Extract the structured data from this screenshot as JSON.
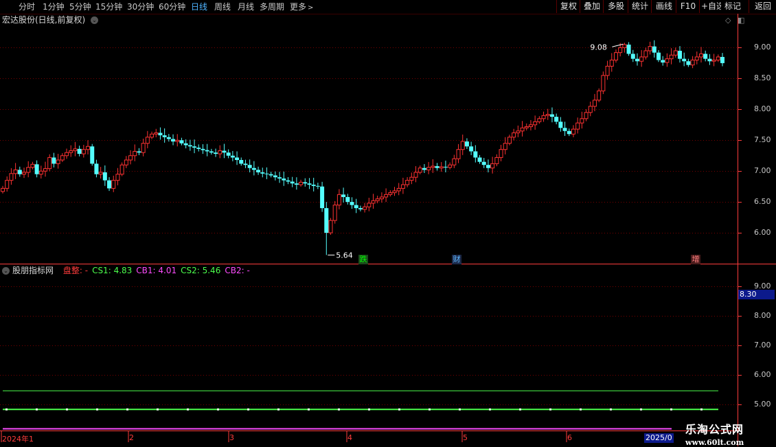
{
  "periods": [
    {
      "label": "分时",
      "active": false
    },
    {
      "label": "1分钟",
      "active": false
    },
    {
      "label": "5分钟",
      "active": false
    },
    {
      "label": "15分钟",
      "active": false
    },
    {
      "label": "30分钟",
      "active": false
    },
    {
      "label": "60分钟",
      "active": false
    },
    {
      "label": "日线",
      "active": true
    },
    {
      "label": "周线",
      "active": false
    },
    {
      "label": "月线",
      "active": false
    },
    {
      "label": "多周期",
      "active": false
    },
    {
      "label": "更多",
      "active": false
    }
  ],
  "toolbar": {
    "restore_rights": "复权",
    "overlay": "叠加",
    "multi_stock": "多股",
    "statistics": "统计",
    "draw_line": "画线",
    "f10": "F10",
    "add_watchlist": "+自选",
    "back": "返回"
  },
  "chart_title": "宏达股份(日线,前复权)",
  "bookmark_label": "标记",
  "indicator": {
    "name": "股朋指标网",
    "items": [
      {
        "label": "盘整",
        "value": "-",
        "color": "#ff3c3c"
      },
      {
        "label": "CS1",
        "value": "4.83",
        "color": "#4cff4c"
      },
      {
        "label": "CB1",
        "value": "4.01",
        "color": "#ff4cff"
      },
      {
        "label": "CS2",
        "value": "5.46",
        "color": "#4cff4c"
      },
      {
        "label": "CB2",
        "value": "-",
        "color": "#ff4cff"
      }
    ]
  },
  "current_price_tag": "8.30",
  "events": [
    {
      "label": "跌",
      "color": "#00ff00",
      "bg": "#1c4a1c"
    },
    {
      "label": "财",
      "color": "#5fb8ff",
      "bg": "#1c2a4a"
    },
    {
      "label": "增",
      "color": "#ff8080",
      "bg": "#4a1c1c"
    }
  ],
  "dates": [
    "2024年1",
    "2",
    "3",
    "4",
    "5",
    "6"
  ],
  "last_date": "2025/0",
  "watermark": {
    "line1": "乐淘公式网",
    "line2": "www.60lt.com"
  },
  "colors": {
    "up": "#ff3232",
    "down": "#54ffff",
    "grid": "#7a0000",
    "axis": "#ff3c3c",
    "active": "#4fb4ff",
    "cs": "#4cff4c",
    "cb": "#ff4cff"
  },
  "chart_data": {
    "type": "candlestick",
    "title": "宏达股份(日线,前复权)",
    "main_axis": {
      "ticks": [
        6.0,
        6.5,
        7.0,
        7.5,
        8.0,
        8.5,
        9.0
      ],
      "range": [
        5.5,
        9.35
      ]
    },
    "indicator_axis": {
      "ticks": [
        5.0,
        6.0,
        7.0,
        8.0,
        9.0
      ],
      "range": [
        4.65,
        9.35
      ]
    },
    "annotations": [
      {
        "label": "9.08",
        "type": "high"
      },
      {
        "label": "5.64",
        "type": "low"
      }
    ],
    "close": [
      6.72,
      6.85,
      6.96,
      7.02,
      6.95,
      6.98,
      7.06,
      7.11,
      6.95,
      7.0,
      7.04,
      7.22,
      7.12,
      7.18,
      7.25,
      7.3,
      7.33,
      7.36,
      7.28,
      7.35,
      7.4,
      7.12,
      6.95,
      6.98,
      6.85,
      6.72,
      6.85,
      6.95,
      7.1,
      7.18,
      7.25,
      7.32,
      7.3,
      7.45,
      7.55,
      7.6,
      7.62,
      7.58,
      7.55,
      7.52,
      7.48,
      7.5,
      7.45,
      7.42,
      7.4,
      7.38,
      7.36,
      7.34,
      7.32,
      7.3,
      7.28,
      7.33,
      7.3,
      7.25,
      7.22,
      7.18,
      7.12,
      7.1,
      7.05,
      7.02,
      6.98,
      6.96,
      6.95,
      6.93,
      6.9,
      6.88,
      6.85,
      6.83,
      6.8,
      6.78,
      6.82,
      6.8,
      6.78,
      6.76,
      6.75,
      6.4,
      6.0,
      6.2,
      6.45,
      6.62,
      6.58,
      6.5,
      6.45,
      6.4,
      6.38,
      6.42,
      6.48,
      6.52,
      6.55,
      6.58,
      6.62,
      6.65,
      6.68,
      6.72,
      6.78,
      6.85,
      6.9,
      6.98,
      7.05,
      7.02,
      7.06,
      7.08,
      7.05,
      7.07,
      7.06,
      7.1,
      7.2,
      7.35,
      7.48,
      7.4,
      7.32,
      7.22,
      7.15,
      7.1,
      7.05,
      7.12,
      7.22,
      7.35,
      7.45,
      7.55,
      7.62,
      7.65,
      7.7,
      7.72,
      7.75,
      7.8,
      7.85,
      7.9,
      7.92,
      7.88,
      7.8,
      7.7,
      7.65,
      7.6,
      7.68,
      7.78,
      7.85,
      7.95,
      8.05,
      8.15,
      8.3,
      8.55,
      8.7,
      8.8,
      8.92,
      9.0,
      9.05,
      8.9,
      8.82,
      8.78,
      8.85,
      8.95,
      9.02,
      8.92,
      8.8,
      8.76,
      8.82,
      8.88,
      8.95,
      8.82,
      8.78,
      8.72,
      8.8,
      8.85,
      8.9,
      8.82,
      8.78,
      8.8,
      8.85,
      8.75
    ]
  }
}
